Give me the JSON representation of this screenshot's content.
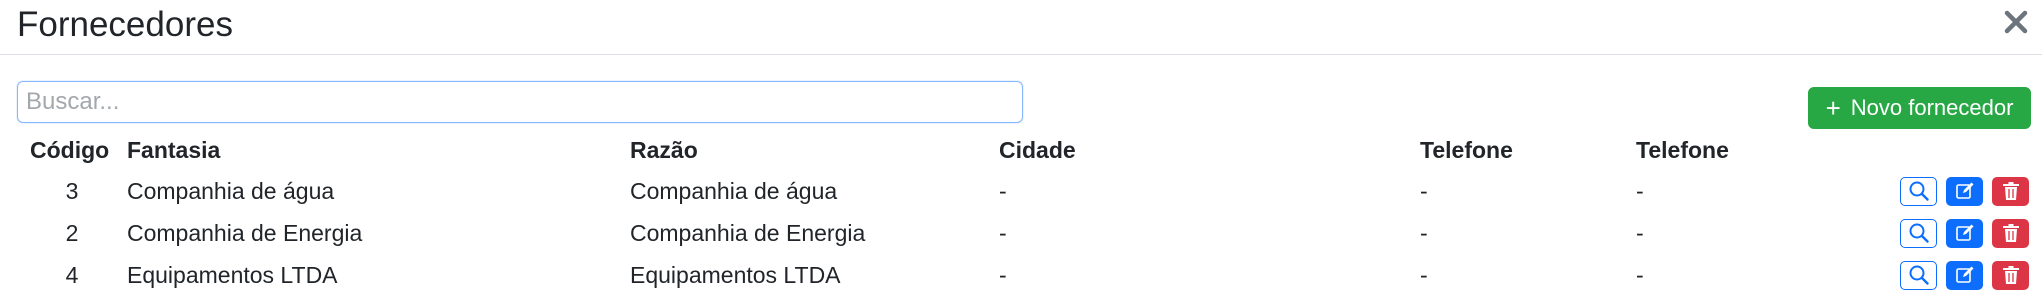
{
  "modal": {
    "title": "Fornecedores"
  },
  "toolbar": {
    "search_placeholder": "Buscar...",
    "search_value": "",
    "new_button_icon": "+",
    "new_button_label": "Novo fornecedor"
  },
  "table": {
    "columns": [
      "Código",
      "Fantasia",
      "Razão",
      "Cidade",
      "Telefone",
      "Telefone"
    ],
    "rows": [
      {
        "codigo": "3",
        "fantasia": "Companhia de água",
        "razao": "Companhia de água",
        "cidade": "-",
        "telefone1": "-",
        "telefone2": "-"
      },
      {
        "codigo": "2",
        "fantasia": "Companhia de Energia",
        "razao": "Companhia de Energia",
        "cidade": "-",
        "telefone1": "-",
        "telefone2": "-"
      },
      {
        "codigo": "4",
        "fantasia": "Equipamentos LTDA",
        "razao": "Equipamentos LTDA",
        "cidade": "-",
        "telefone1": "-",
        "telefone2": "-"
      }
    ]
  },
  "icons": {
    "close": "close-icon",
    "view": "magnifier-icon",
    "edit": "pencil-square-icon",
    "delete": "trash-icon"
  },
  "colors": {
    "success": "#28a745",
    "primary": "#0d6efd",
    "danger": "#dc3545",
    "focus_border": "#86b7fe"
  }
}
